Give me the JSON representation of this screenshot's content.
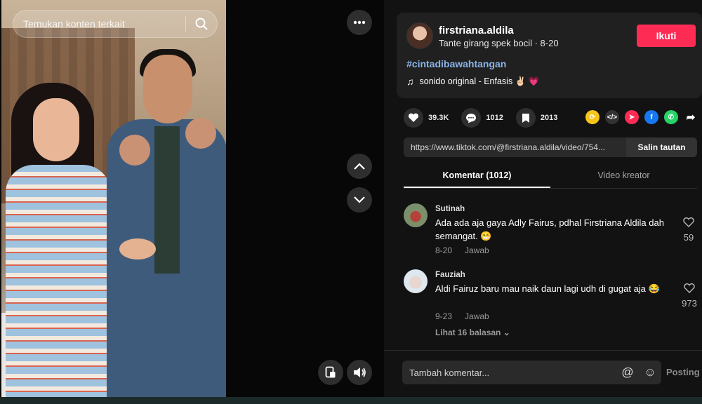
{
  "search": {
    "placeholder": "Temukan konten terkait"
  },
  "author": {
    "username": "firstriana.aldila",
    "subtitle": "Tante girang spek bocil · 8-20",
    "follow_label": "Ikuti"
  },
  "post": {
    "hashtag": "#cintadibawahtangan",
    "music": "sonido original - Enfasis ✌🏻 💗"
  },
  "stats": {
    "likes": "39.3K",
    "comments": "1012",
    "saves": "2013"
  },
  "link": {
    "url": "https://www.tiktok.com/@firstriana.aldila/video/754...",
    "copy_label": "Salin tautan"
  },
  "tabs": [
    {
      "label": "Komentar (1012)"
    },
    {
      "label": "Video kreator"
    }
  ],
  "comments": [
    {
      "name": "Sutinah",
      "text": "Ada ada aja gaya Adly Fairus, pdhal Firstriana Aldila dah semangat. 😁",
      "date": "8-20",
      "reply_label": "Jawab",
      "likes": "59"
    },
    {
      "name": "Fauziah",
      "text": "Aldi Fairuz baru mau naik daun lagi udh di gugat aja 😂",
      "date": "9-23",
      "reply_label": "Jawab",
      "likes": "973",
      "replies_label": "Lihat 16 balasan"
    }
  ],
  "comment_box": {
    "placeholder": "Tambah komentar...",
    "post_label": "Posting"
  },
  "colors": {
    "accent": "#fe2c55",
    "hashtag": "#8ab4e8",
    "panel_bg": "#121212"
  },
  "icons": [
    "search-icon",
    "more-icon",
    "chevron-up-icon",
    "chevron-down-icon",
    "pip-icon",
    "volume-icon",
    "heart-icon",
    "comment-icon",
    "bookmark-icon",
    "embed-icon",
    "send-icon",
    "facebook-icon",
    "whatsapp-icon",
    "share-arrow-icon",
    "mention-icon",
    "emoji-icon"
  ]
}
